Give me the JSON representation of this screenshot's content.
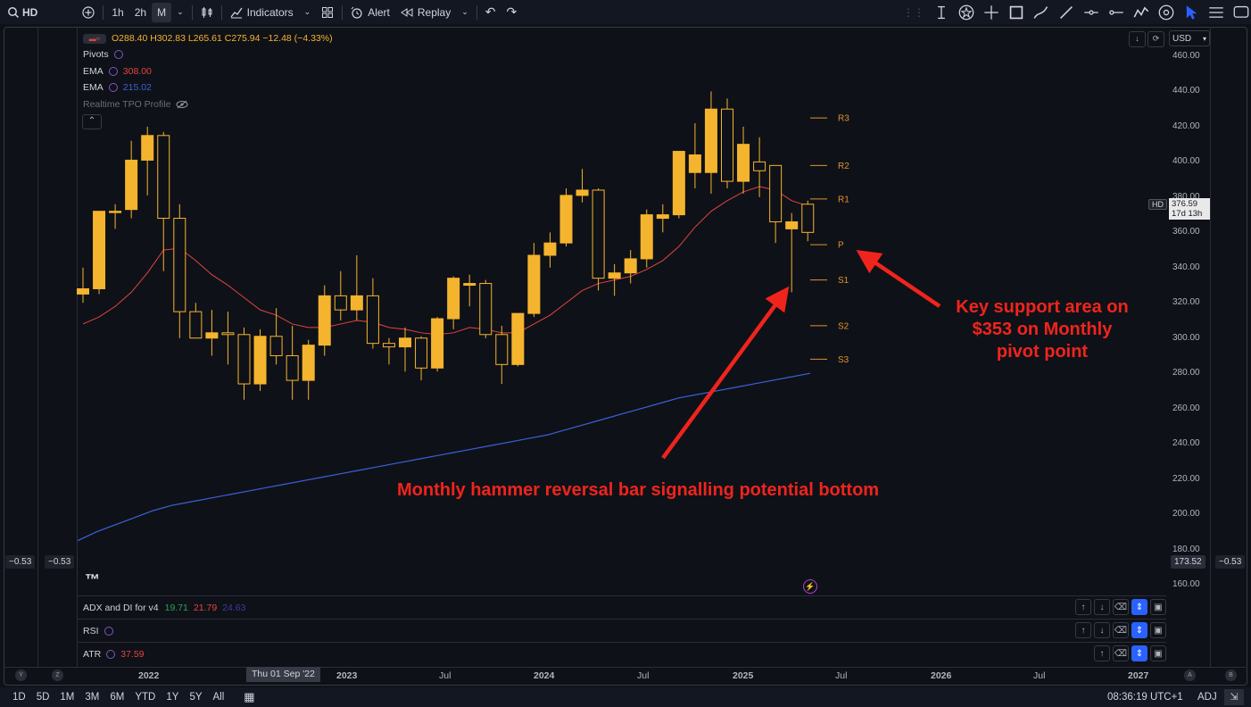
{
  "toolbar": {
    "symbol": "HD",
    "intervals": [
      "1h",
      "2h",
      "M"
    ],
    "active_interval": "M",
    "indicators_label": "Indicators",
    "alert_label": "Alert",
    "replay_label": "Replay"
  },
  "ohlc": {
    "o": "O288.40",
    "h": "H302.83",
    "l": "L265.61",
    "c": "C275.94",
    "chg": "−12.48 (−4.33%)"
  },
  "legend": {
    "pivots": "Pivots",
    "ema1_name": "EMA",
    "ema1_val": "308.00",
    "ema2_name": "EMA",
    "ema2_val": "215.02",
    "tpo": "Realtime TPO Profile"
  },
  "currency": "USD",
  "price_ticks": [
    "460.00",
    "440.00",
    "420.00",
    "400.00",
    "380.00",
    "360.00",
    "340.00",
    "320.00",
    "300.00",
    "280.00",
    "260.00",
    "240.00",
    "220.00",
    "200.00",
    "180.00",
    "160.00"
  ],
  "last_price": {
    "symbol": "HD",
    "price": "376.59",
    "countdown": "17d 13h"
  },
  "side_values": {
    "left1": "−0.53",
    "left2": "−0.53",
    "right_price": "173.52",
    "right": "−0.53"
  },
  "panes": [
    {
      "name": "ADX and DI for v4",
      "v1": "19.71",
      "v2": "21.79",
      "v3": "24.63"
    },
    {
      "name": "RSI"
    },
    {
      "name": "ATR",
      "v1": "37.59"
    }
  ],
  "time_axis": {
    "labels": [
      "2022",
      "2023",
      "Jul",
      "2024",
      "Jul",
      "2025",
      "Jul",
      "2026",
      "Jul",
      "2027"
    ],
    "crosshair": "Thu 01 Sep '22",
    "left_btns": [
      "Y",
      "Z"
    ],
    "right_btns": [
      "A",
      "B"
    ]
  },
  "bottom": {
    "ranges": [
      "1D",
      "5D",
      "1M",
      "3M",
      "6M",
      "YTD",
      "1Y",
      "5Y",
      "All"
    ],
    "clock": "08:36:19 UTC+1",
    "adj": "ADJ"
  },
  "annotations": {
    "support": [
      "Key support area on",
      "$353 on Monthly",
      "pivot point"
    ],
    "hammer": "Monthly hammer reversal bar signalling potential bottom"
  },
  "colors": {
    "candle": "#f5b42e",
    "ema_red": "#e0453f",
    "ema_blue": "#3a62d8",
    "pivot": "#e0932a",
    "arrow": "#f0241c"
  },
  "chart_data": {
    "type": "candlestick",
    "title": "",
    "ylim": [
      150,
      470
    ],
    "candles": [
      {
        "t": "2021-08",
        "o": 325,
        "h": 340,
        "l": 320,
        "c": 328
      },
      {
        "t": "2021-09",
        "o": 328,
        "h": 345,
        "l": 325,
        "c": 372
      },
      {
        "t": "2021-10",
        "o": 372,
        "h": 376,
        "l": 362,
        "c": 372
      },
      {
        "t": "2021-11",
        "o": 373,
        "h": 412,
        "l": 368,
        "c": 401
      },
      {
        "t": "2021-12",
        "o": 401,
        "h": 420,
        "l": 381,
        "c": 415
      },
      {
        "t": "2022-01",
        "o": 415,
        "h": 417,
        "l": 338,
        "c": 368
      },
      {
        "t": "2022-02",
        "o": 368,
        "h": 376,
        "l": 300,
        "c": 315
      },
      {
        "t": "2022-03",
        "o": 315,
        "h": 320,
        "l": 300,
        "c": 300
      },
      {
        "t": "2022-04",
        "o": 300,
        "h": 316,
        "l": 290,
        "c": 303
      },
      {
        "t": "2022-05",
        "o": 303,
        "h": 315,
        "l": 285,
        "c": 302
      },
      {
        "t": "2022-06",
        "o": 302,
        "h": 306,
        "l": 265,
        "c": 274
      },
      {
        "t": "2022-07",
        "o": 274,
        "h": 305,
        "l": 270,
        "c": 301
      },
      {
        "t": "2022-08",
        "o": 301,
        "h": 317,
        "l": 285,
        "c": 290
      },
      {
        "t": "2022-09",
        "o": 290,
        "h": 307,
        "l": 265,
        "c": 276
      },
      {
        "t": "2022-10",
        "o": 276,
        "h": 299,
        "l": 265,
        "c": 296
      },
      {
        "t": "2022-11",
        "o": 296,
        "h": 330,
        "l": 290,
        "c": 324
      },
      {
        "t": "2022-12",
        "o": 324,
        "h": 338,
        "l": 310,
        "c": 316
      },
      {
        "t": "2023-01",
        "o": 316,
        "h": 347,
        "l": 310,
        "c": 324
      },
      {
        "t": "2023-02",
        "o": 324,
        "h": 334,
        "l": 294,
        "c": 297
      },
      {
        "t": "2023-03",
        "o": 297,
        "h": 300,
        "l": 285,
        "c": 295
      },
      {
        "t": "2023-04",
        "o": 295,
        "h": 306,
        "l": 281,
        "c": 300
      },
      {
        "t": "2023-05",
        "o": 300,
        "h": 301,
        "l": 276,
        "c": 283
      },
      {
        "t": "2023-06",
        "o": 283,
        "h": 312,
        "l": 281,
        "c": 311
      },
      {
        "t": "2023-07",
        "o": 311,
        "h": 335,
        "l": 305,
        "c": 334
      },
      {
        "t": "2023-08",
        "o": 330,
        "h": 336,
        "l": 318,
        "c": 331
      },
      {
        "t": "2023-09",
        "o": 331,
        "h": 333,
        "l": 300,
        "c": 302
      },
      {
        "t": "2023-10",
        "o": 302,
        "h": 307,
        "l": 274,
        "c": 285
      },
      {
        "t": "2023-11",
        "o": 285,
        "h": 314,
        "l": 284,
        "c": 314
      },
      {
        "t": "2023-12",
        "o": 314,
        "h": 354,
        "l": 312,
        "c": 347
      },
      {
        "t": "2024-01",
        "o": 347,
        "h": 360,
        "l": 340,
        "c": 354
      },
      {
        "t": "2024-02",
        "o": 354,
        "h": 385,
        "l": 352,
        "c": 381
      },
      {
        "t": "2024-03",
        "o": 381,
        "h": 396,
        "l": 377,
        "c": 384
      },
      {
        "t": "2024-04",
        "o": 384,
        "h": 385,
        "l": 327,
        "c": 334
      },
      {
        "t": "2024-05",
        "o": 334,
        "h": 342,
        "l": 324,
        "c": 337
      },
      {
        "t": "2024-06",
        "o": 337,
        "h": 350,
        "l": 331,
        "c": 345
      },
      {
        "t": "2024-07",
        "o": 345,
        "h": 373,
        "l": 340,
        "c": 370
      },
      {
        "t": "2024-08",
        "o": 368,
        "h": 376,
        "l": 360,
        "c": 370
      },
      {
        "t": "2024-09",
        "o": 370,
        "h": 401,
        "l": 368,
        "c": 406
      },
      {
        "t": "2024-10",
        "o": 394,
        "h": 422,
        "l": 385,
        "c": 404
      },
      {
        "t": "2024-11",
        "o": 394,
        "h": 440,
        "l": 382,
        "c": 430
      },
      {
        "t": "2024-12",
        "o": 430,
        "h": 436,
        "l": 385,
        "c": 389
      },
      {
        "t": "2025-01",
        "o": 389,
        "h": 420,
        "l": 382,
        "c": 410
      },
      {
        "t": "2025-02",
        "o": 400,
        "h": 414,
        "l": 380,
        "c": 395
      },
      {
        "t": "2025-03",
        "o": 398,
        "h": 398,
        "l": 354,
        "c": 366
      },
      {
        "t": "2025-04",
        "o": 362,
        "h": 371,
        "l": 326,
        "c": 366
      },
      {
        "t": "2025-05",
        "o": 376,
        "h": 378,
        "l": 355,
        "c": 360
      }
    ],
    "ema_red": [
      308,
      312,
      318,
      326,
      337,
      350,
      351,
      344,
      336,
      330,
      323,
      316,
      313,
      308,
      306,
      306,
      308,
      310,
      309,
      306,
      305,
      303,
      302,
      303,
      306,
      305,
      303,
      303,
      308,
      313,
      320,
      327,
      331,
      333,
      335,
      339,
      344,
      352,
      363,
      372,
      378,
      383,
      386,
      384,
      378,
      375
    ],
    "ema_blue": [
      185,
      190,
      194,
      198,
      202,
      205,
      207,
      209,
      211,
      213,
      215,
      217,
      219,
      221,
      223,
      225,
      227,
      229,
      231,
      233,
      235,
      237,
      239,
      241,
      243,
      245,
      248,
      251,
      254,
      257,
      260,
      263,
      266,
      268,
      270,
      272,
      274,
      276,
      278,
      280
    ],
    "pivots": [
      {
        "label": "R3",
        "value": 425
      },
      {
        "label": "R2",
        "value": 398
      },
      {
        "label": "R1",
        "value": 379
      },
      {
        "label": "P",
        "value": 353
      },
      {
        "label": "S1",
        "value": 333
      },
      {
        "label": "S2",
        "value": 307
      },
      {
        "label": "S3",
        "value": 288
      }
    ]
  }
}
